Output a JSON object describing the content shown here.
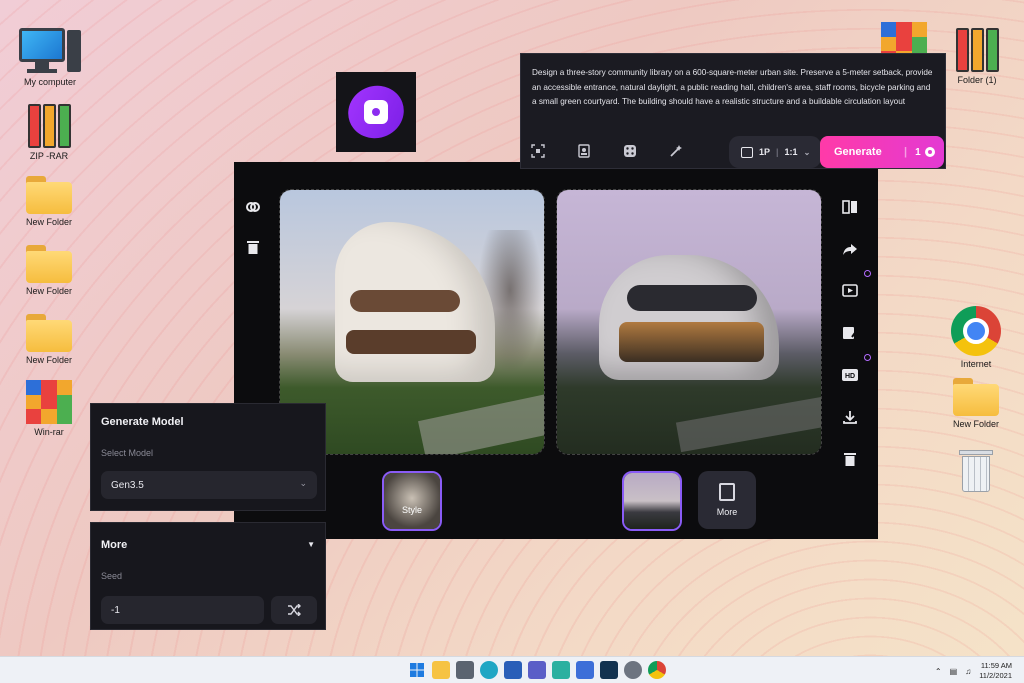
{
  "desktop": {
    "icons_left": [
      {
        "label": "My computer",
        "icon": "computer-icon"
      },
      {
        "label": "ZIP -RAR",
        "icon": "rar-archive-icon"
      },
      {
        "label": "New Folder",
        "icon": "folder-icon"
      },
      {
        "label": "New Folder",
        "icon": "folder-icon"
      },
      {
        "label": "New Folder",
        "icon": "folder-icon"
      },
      {
        "label": "Win-rar",
        "icon": "winrar-icon"
      }
    ],
    "icons_right": [
      {
        "label": "Folder (1)",
        "icon": "rar-archive-icon"
      },
      {
        "label": "Internet",
        "icon": "chrome-icon"
      },
      {
        "label": "New Folder",
        "icon": "folder-icon"
      },
      {
        "label": "",
        "icon": "recycle-bin-icon"
      }
    ]
  },
  "prompt": {
    "text": "Design a three-story community library on a 600-square-meter urban site. Preserve a 5-meter setback, provide an accessible entrance, natural daylight, a public reading hall, children's area, staff rooms, bicycle parking and a small green courtyard. The building should have a realistic structure and a buildable circulation layout",
    "tools": [
      "scan-icon",
      "portrait-icon",
      "dice-icon",
      "magic-wand-icon"
    ],
    "ratio_count": "1P",
    "ratio_value": "1:1",
    "generate_label": "Generate",
    "generate_cost": "1"
  },
  "canvas": {
    "left_tools": [
      "link-icon",
      "trash-icon"
    ],
    "right_tools": [
      "compare-icon",
      "share-icon",
      "play-icon",
      "edit-icon",
      "hd-icon",
      "download-icon",
      "trash-icon"
    ],
    "thumb_style_label": "Style",
    "more_label": "More"
  },
  "model_panel": {
    "title": "Generate Model",
    "select_label": "Select Model",
    "selected_model": "Gen3.5"
  },
  "more_panel": {
    "title": "More",
    "seed_label": "Seed",
    "seed_value": "-1"
  },
  "taskbar": {
    "time": "11:59 AM",
    "date": "11/2/2021"
  },
  "colors": {
    "accent": "#8a5cf6",
    "generate_gradient_start": "#ff3aa8",
    "generate_gradient_end": "#e33ad3",
    "panel_bg": "#17171d"
  }
}
